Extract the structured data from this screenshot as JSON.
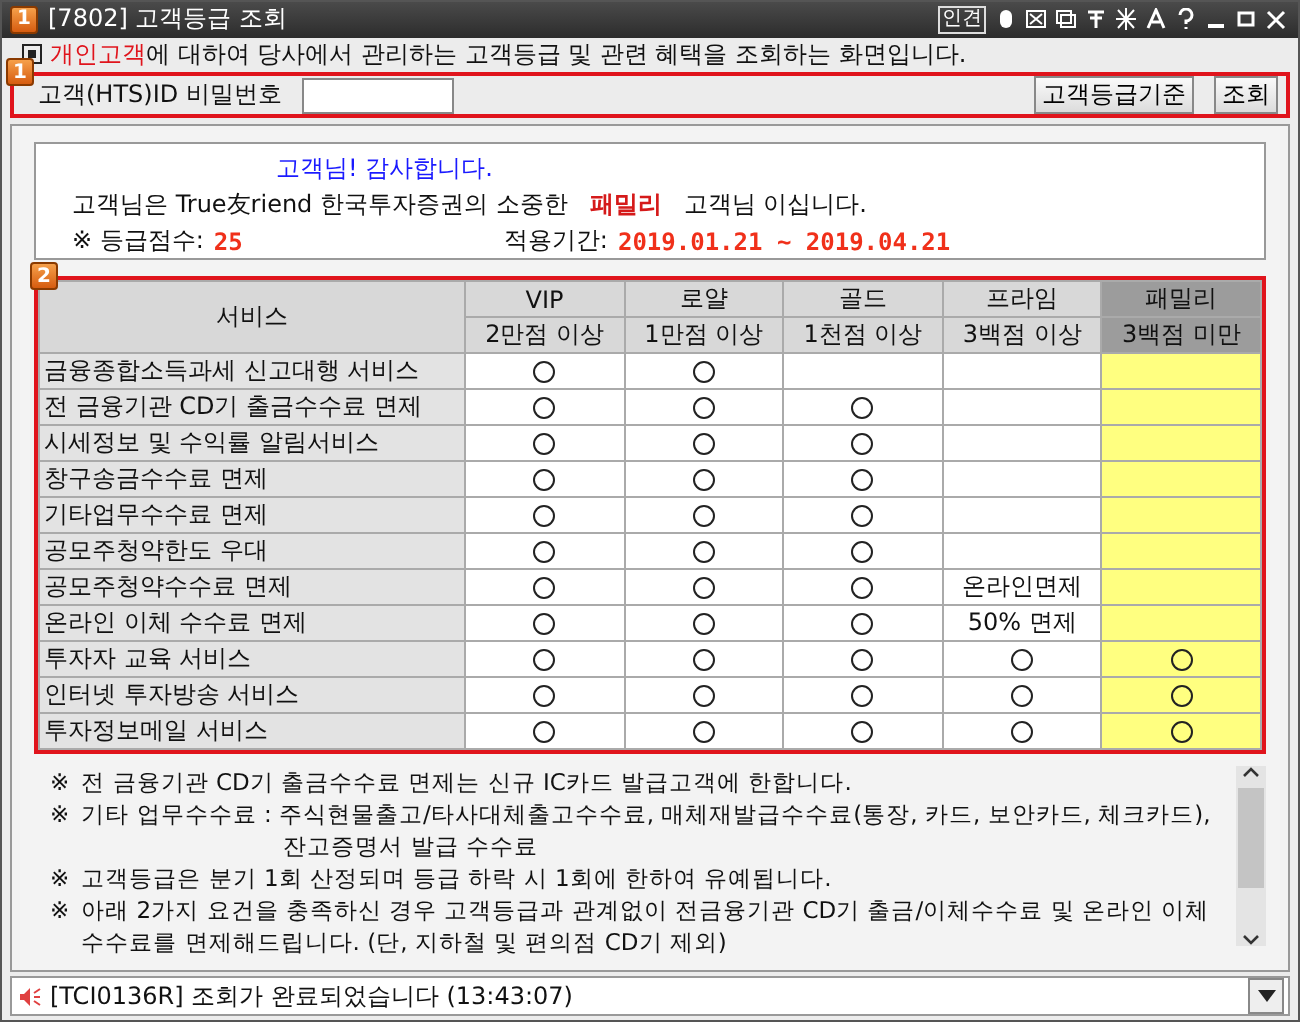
{
  "window": {
    "badge": "1",
    "title": "[7802] 고객등급 조회",
    "toolbar_text": "인견"
  },
  "intro": {
    "highlight": "개인고객",
    "text": "에 대하여 당사에서 관리하는 고객등급 및 관련 혜택을 조회하는 화면입니다."
  },
  "section1": {
    "badge": "1",
    "label": "고객(HTS)ID 비밀번호",
    "buttons": [
      "고객등급기준",
      "조회"
    ]
  },
  "info": {
    "greeting": "고객님! 감사합니다.",
    "line_before": "고객님은 True友riend 한국투자증권의 소중한",
    "grade": "패밀리",
    "line_after": "고객님 이십니다.",
    "score_label": "※ 등급점수:",
    "score": "25",
    "period_label": "적용기간:",
    "period": "2019.01.21 ~ 2019.04.21"
  },
  "table": {
    "badge": "2",
    "service_header": "서비스",
    "columns": [
      {
        "name": "VIP",
        "threshold": "2만점 이상",
        "selected": false
      },
      {
        "name": "로얄",
        "threshold": "1만점 이상",
        "selected": false
      },
      {
        "name": "골드",
        "threshold": "1천점 이상",
        "selected": false
      },
      {
        "name": "프라임",
        "threshold": "3백점 이상",
        "selected": false
      },
      {
        "name": "패밀리",
        "threshold": "3백점 미만",
        "selected": true
      }
    ],
    "rows": [
      {
        "service": "금융종합소득과세 신고대행 서비스",
        "cells": [
          {
            "kind": "circle"
          },
          {
            "kind": "circle"
          },
          {
            "kind": "empty"
          },
          {
            "kind": "empty"
          },
          {
            "kind": "empty"
          }
        ]
      },
      {
        "service": "전 금융기관 CD기 출금수수료 면제",
        "cells": [
          {
            "kind": "circle"
          },
          {
            "kind": "circle"
          },
          {
            "kind": "circle"
          },
          {
            "kind": "empty"
          },
          {
            "kind": "empty"
          }
        ]
      },
      {
        "service": "시세정보 및 수익률 알림서비스",
        "cells": [
          {
            "kind": "circle"
          },
          {
            "kind": "circle"
          },
          {
            "kind": "circle"
          },
          {
            "kind": "empty"
          },
          {
            "kind": "empty"
          }
        ]
      },
      {
        "service": "창구송금수수료 면제",
        "cells": [
          {
            "kind": "circle"
          },
          {
            "kind": "circle"
          },
          {
            "kind": "circle"
          },
          {
            "kind": "empty"
          },
          {
            "kind": "empty"
          }
        ]
      },
      {
        "service": "기타업무수수료 면제",
        "cells": [
          {
            "kind": "circle"
          },
          {
            "kind": "circle"
          },
          {
            "kind": "circle"
          },
          {
            "kind": "empty"
          },
          {
            "kind": "empty"
          }
        ]
      },
      {
        "service": "공모주청약한도 우대",
        "cells": [
          {
            "kind": "circle"
          },
          {
            "kind": "circle"
          },
          {
            "kind": "circle"
          },
          {
            "kind": "empty"
          },
          {
            "kind": "empty"
          }
        ]
      },
      {
        "service": "공모주청약수수료 면제",
        "cells": [
          {
            "kind": "circle"
          },
          {
            "kind": "circle"
          },
          {
            "kind": "circle"
          },
          {
            "kind": "text",
            "text": "온라인면제"
          },
          {
            "kind": "empty"
          }
        ]
      },
      {
        "service": "온라인 이체 수수료 면제",
        "cells": [
          {
            "kind": "circle"
          },
          {
            "kind": "circle"
          },
          {
            "kind": "circle"
          },
          {
            "kind": "text",
            "text": "50% 면제"
          },
          {
            "kind": "empty"
          }
        ]
      },
      {
        "service": "투자자 교육 서비스",
        "cells": [
          {
            "kind": "circle"
          },
          {
            "kind": "circle"
          },
          {
            "kind": "circle"
          },
          {
            "kind": "circle"
          },
          {
            "kind": "circle"
          }
        ]
      },
      {
        "service": "인터넷 투자방송 서비스",
        "cells": [
          {
            "kind": "circle"
          },
          {
            "kind": "circle"
          },
          {
            "kind": "circle"
          },
          {
            "kind": "circle"
          },
          {
            "kind": "circle"
          }
        ]
      },
      {
        "service": "투자정보메일 서비스",
        "cells": [
          {
            "kind": "circle"
          },
          {
            "kind": "circle"
          },
          {
            "kind": "circle"
          },
          {
            "kind": "circle"
          },
          {
            "kind": "circle"
          }
        ]
      }
    ]
  },
  "notes": [
    {
      "mark": "※",
      "text": "전 금융기관 CD기 출금수수료 면제는 신규 IC카드 발급고객에 한합니다."
    },
    {
      "mark": "※",
      "text": "기타 업무수수료 : 주식현물출고/타사대체출고수수료, 매체재발급수수료(통장, 카드, 보안카드, 체크카드),",
      "continuation": "잔고증명서 발급 수수료"
    },
    {
      "mark": "※",
      "text": "고객등급은 분기 1회 산정되며 등급 하락 시  1회에 한하여 유예됩니다."
    },
    {
      "mark": "※",
      "text": "아래 2가지 요건을 충족하신 경우 고객등급과 관계없이 전금융기관 CD기 출금/이체수수료 및 온라인 이체",
      "continuation": "수수료를 면제해드립니다. (단, 지하철 및 편의점 CD기 제외)"
    }
  ],
  "status_bar": {
    "message": "[TCI0136R] 조회가 완료되었습니다 (13:43:07)"
  }
}
